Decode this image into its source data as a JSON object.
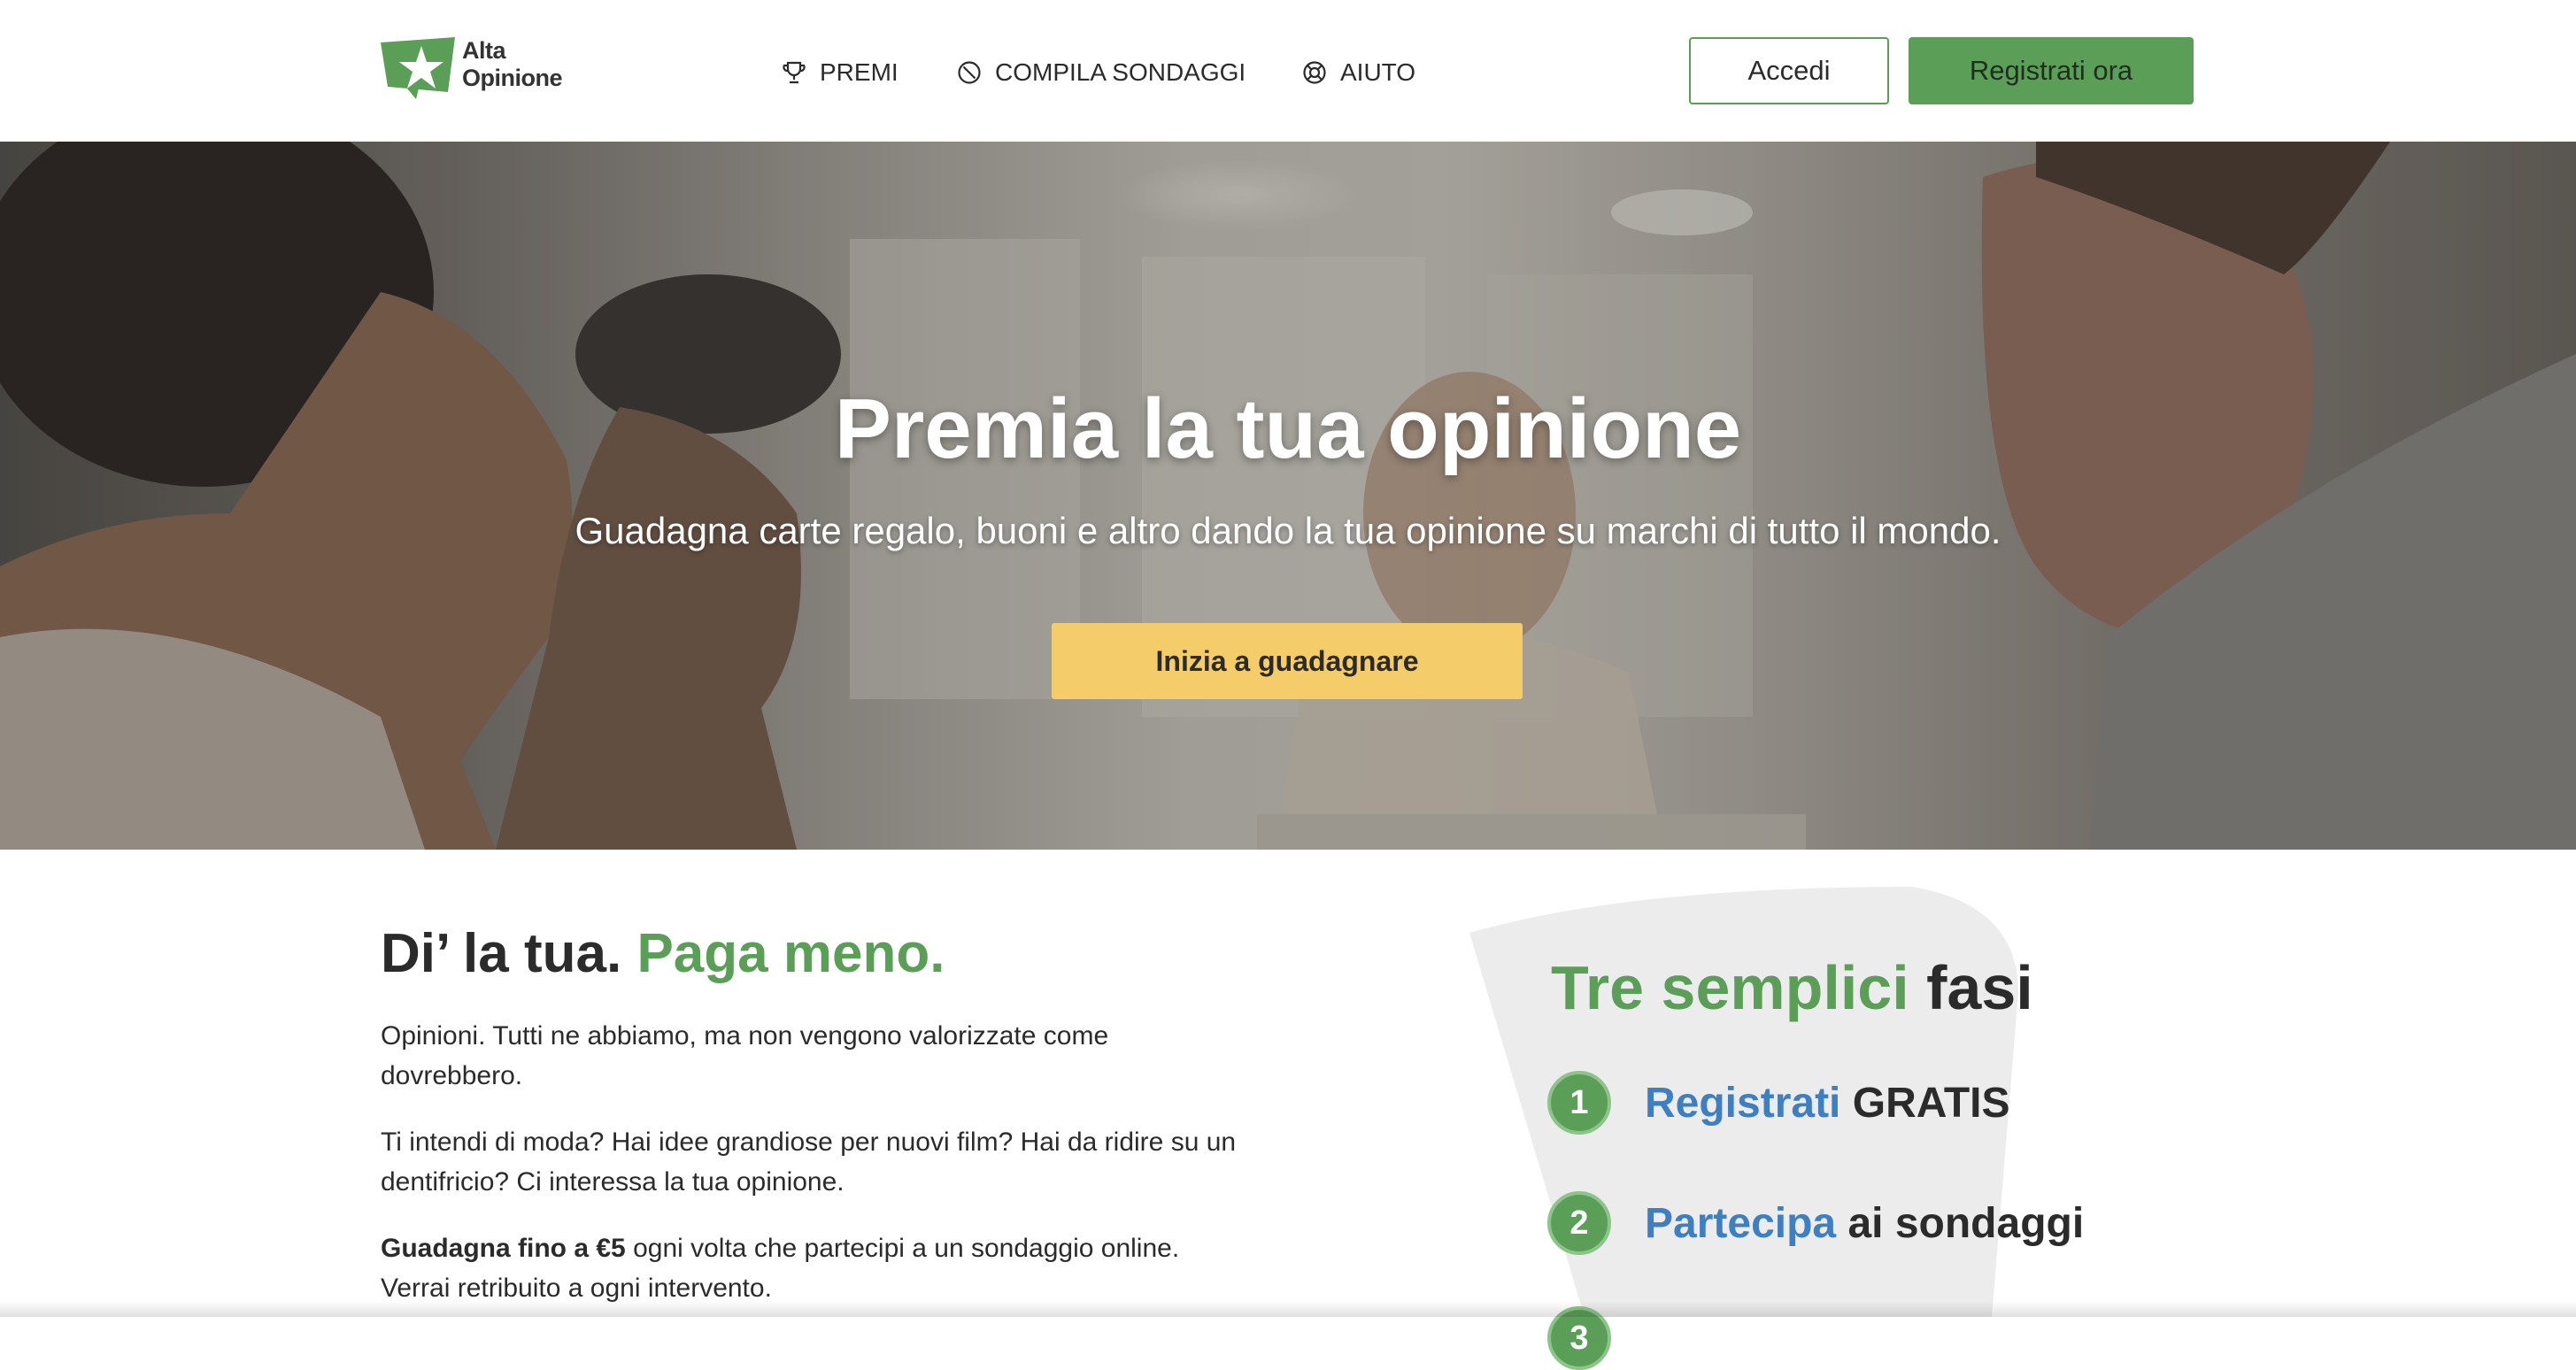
{
  "brand": {
    "logo_line1": "Alta",
    "logo_line2": "Opinione",
    "green": "#5b9e58",
    "blue": "#3d7fc1",
    "yellow": "#f4cd6a"
  },
  "nav": {
    "items": [
      {
        "label": "PREMI",
        "icon": "trophy-icon"
      },
      {
        "label": "COMPILA SONDAGGI",
        "icon": "ban-circle-icon"
      },
      {
        "label": "AIUTO",
        "icon": "lifebuoy-icon"
      }
    ],
    "login_label": "Accedi",
    "register_label": "Registrati ora"
  },
  "hero": {
    "title": "Premia la tua opinione",
    "subtitle": "Guadagna carte regalo, buoni e altro dando la tua opinione su marchi di tutto il mondo.",
    "cta_label": "Inizia a guadagnare"
  },
  "intro": {
    "heading_dark": "Di’ la tua.",
    "heading_green": "Paga meno.",
    "paragraphs": [
      "Opinioni. Tutti ne abbiamo, ma non vengono valorizzate come dovrebbero.",
      "Ti intendi di moda? Hai idee grandiose per nuovi film? Hai da ridire su un dentifricio? Ci interessa la tua opinione."
    ],
    "p3_bold": "Guadagna fino a €5",
    "p3_rest": " ogni volta che partecipi a un sondaggio online. Verrai retribuito a ogni intervento."
  },
  "steps": {
    "title_green": "Tre semplici",
    "title_dark": "fasi",
    "items": [
      {
        "number": "1",
        "blue": "Registrati",
        "dark": "GRATIS"
      },
      {
        "number": "2",
        "blue": "Partecipa",
        "dark": "ai sondaggi"
      },
      {
        "number": "3",
        "blue": "",
        "dark": ""
      }
    ]
  }
}
